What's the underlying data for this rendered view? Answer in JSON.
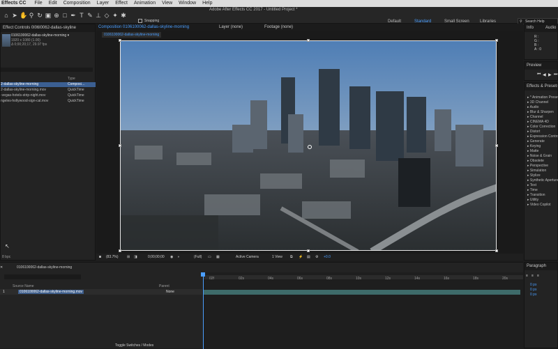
{
  "menubar": {
    "app": "Effects CC",
    "items": [
      "File",
      "Edit",
      "Composition",
      "Layer",
      "Effect",
      "Animation",
      "View",
      "Window",
      "Help"
    ],
    "window_title": "Adobe After Effects CC 2017 - Untitled Project *"
  },
  "toolbar": {
    "snapping_label": "Snapping",
    "workspaces": [
      "Default",
      "Standard",
      "Small Screen",
      "Libraries"
    ],
    "active_workspace": "Standard",
    "search_placeholder": "Search Help"
  },
  "project_panel": {
    "header": "Effect Controls 0l06l0062-dallas-skyline",
    "selected_name": "0106100062-dallas-skyline-morning ▾",
    "selected_info1": "1920 x 1080 (1.00)",
    "selected_info2": "Δ 0;00;20;17, 29.97 fps",
    "col_type": "Type",
    "rows": [
      {
        "name": "2-dallas-skyline-morning",
        "type": "Composi…",
        "selected": true
      },
      {
        "name": "2-dallas-skyline-morning.mov",
        "type": "QuickTime",
        "selected": false
      },
      {
        "name": "-vegas-hotels-strip-night.mov",
        "type": "QuickTime",
        "selected": false
      },
      {
        "name": "ngeles-hollywood-sign-cal.mov",
        "type": "QuickTime",
        "selected": false
      }
    ],
    "bpc": "8 bpc"
  },
  "composition_panel": {
    "tab_comp": "Composition 0106100062-dallas-skyline-morning",
    "tab_layer": "Layer (none)",
    "tab_footage": "Footage (none)",
    "sub_tab": "0106100062-dallas-skyline-morning",
    "zoom": "(83.7%)",
    "timecode": "0;00;00;00",
    "resolution": "(Full)",
    "camera": "Active Camera",
    "views": "1 View",
    "exposure": "+0.0"
  },
  "right_panels": {
    "info_tab": "Info",
    "audio_tab": "Audio",
    "info_lines": [
      "R :",
      "G :",
      "B :",
      "A : 0"
    ],
    "preview_tab": "Preview",
    "effects_tab": "Effects & Presets",
    "effects": [
      "* Animation Presets",
      "3D Channel",
      "Audio",
      "Blur & Sharpen",
      "Channel",
      "CINEMA 4D",
      "Color Correction",
      "Distort",
      "Expression Controls",
      "Generate",
      "Keying",
      "Matte",
      "Noise & Grain",
      "Obsolete",
      "Perspective",
      "Simulation",
      "Stylize",
      "Synthetic Aperture",
      "Text",
      "Time",
      "Transition",
      "Utility",
      "Video Copilot"
    ],
    "paragraph_tab": "Paragraph",
    "para_values": [
      "0 px",
      "0 px",
      "0 px"
    ]
  },
  "timeline": {
    "tab": "0106100062-dallas-skyline-morning",
    "col_source": "Source Name",
    "col_parent": "Parent",
    "layer_number": "1",
    "layer_name": "0106100062-dallas-skyline-morning.mov",
    "parent_value": "None",
    "ticks": [
      "02f",
      "02s",
      "04s",
      "06s",
      "08s",
      "10s",
      "12s",
      "14s",
      "16s",
      "18s",
      "20s"
    ],
    "toggle_label": "Toggle Switches / Modes",
    "colors": {
      "playhead": "#4a9eff",
      "layer_bar": "#3e6b6a"
    }
  }
}
